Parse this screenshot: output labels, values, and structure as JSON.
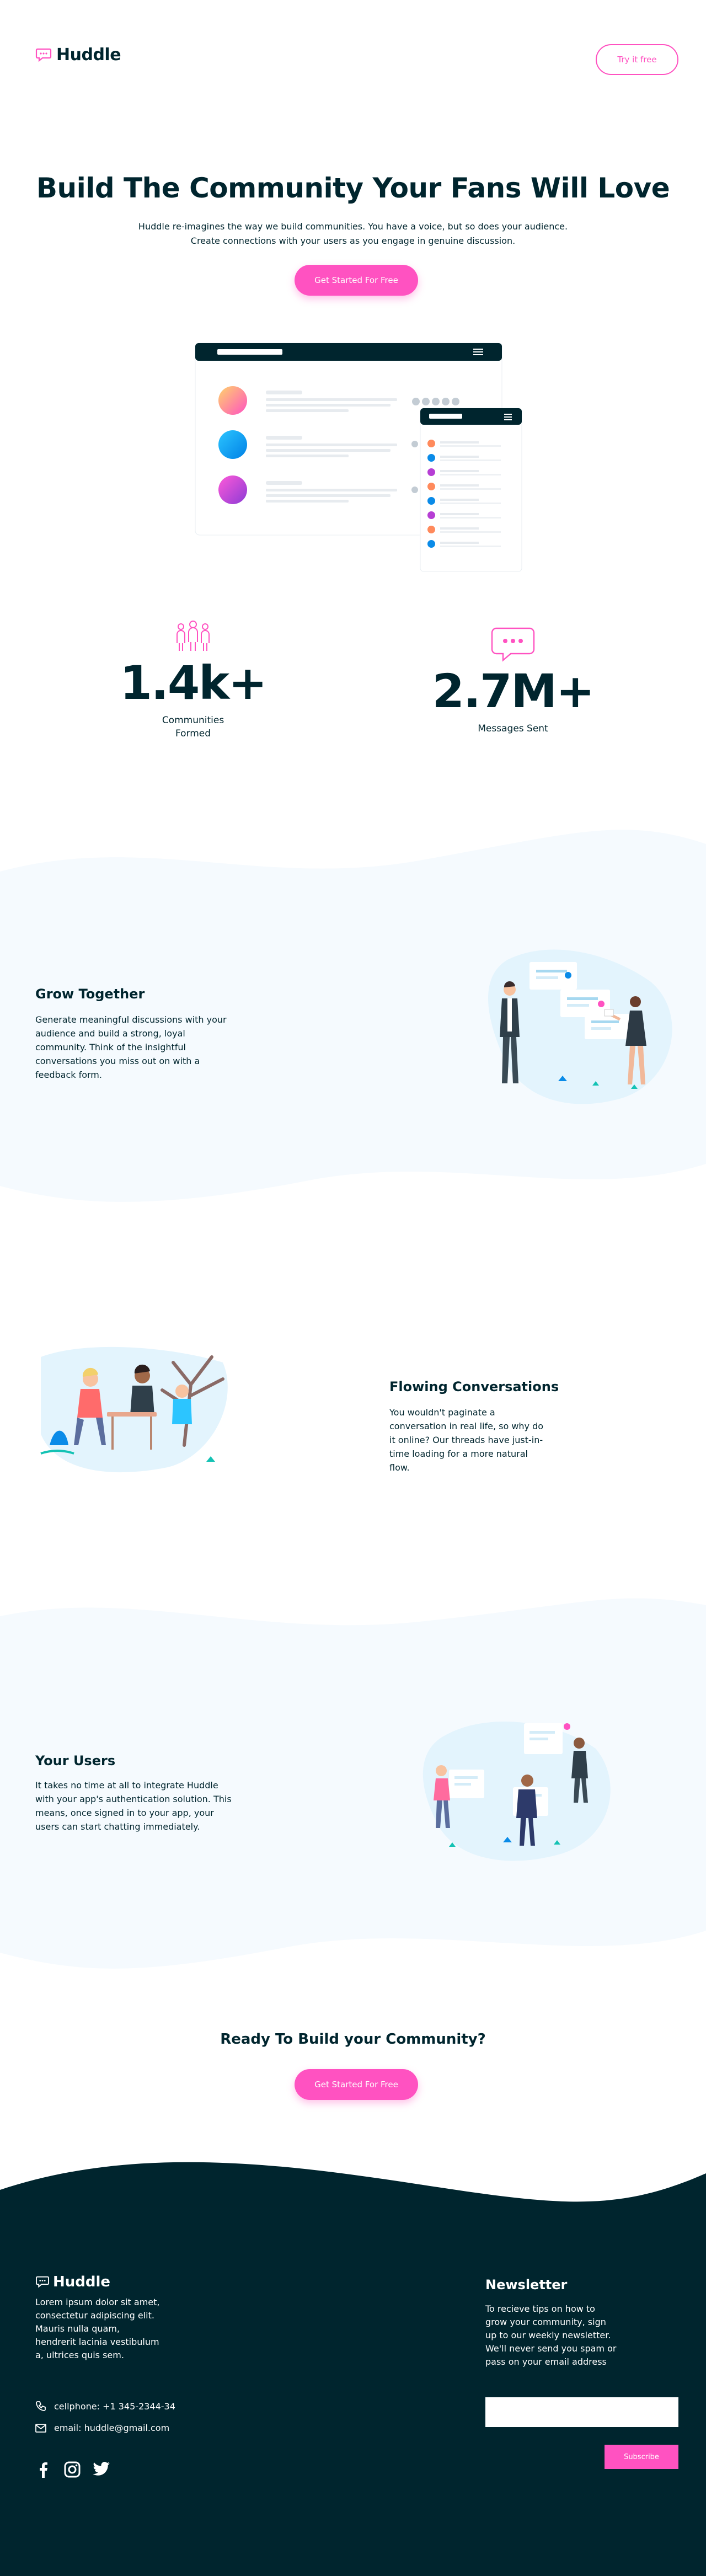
{
  "header": {
    "logo_text": "Huddle",
    "try_button": "Try it free"
  },
  "hero": {
    "title": "Build The Community Your Fans Will Love",
    "description": "Huddle re-imagines the way we build communities. You have a voice, but so does your audience. Create connections with your users as you engage in genuine discussion.",
    "cta": "Get Started For Free"
  },
  "stats": [
    {
      "value": "1.4k+",
      "label": "Communities Formed",
      "icon": "people-icon"
    },
    {
      "value": "2.7M+",
      "label": "Messages Sent",
      "icon": "chat-bubble-icon"
    }
  ],
  "features": [
    {
      "title": "Grow Together",
      "text": "Generate meaningful discussions with your audience and build a strong, loyal community. Think of the insightful conversations you miss out on with a feedback form."
    },
    {
      "title": "Flowing Conversations",
      "text": "You wouldn't paginate a conversation in real life, so why do it online? Our threads have just-in-time loading for a more natural flow."
    },
    {
      "title": "Your Users",
      "text": "It takes no time at all to integrate Huddle with your app's authentication solution. This means, once signed in to your app, your users can start chatting immediately."
    }
  ],
  "ready": {
    "title": "Ready To Build your Community?",
    "cta": "Get Started For Free"
  },
  "footer": {
    "logo_text": "Huddle",
    "description": "Lorem ipsum dolor sit amet, consectetur adipiscing elit. Mauris nulla quam, hendrerit lacinia vestibulum a, ultrices quis sem.",
    "phone": "cellphone: +1 345-2344-34",
    "email": "email: huddle@gmail.com",
    "social": [
      "facebook-icon",
      "instagram-icon",
      "twitter-icon"
    ],
    "newsletter": {
      "title": "Newsletter",
      "description": "To recieve tips on how to grow your community, sign up to our weekly newsletter. We'll never send you spam or pass on your email address",
      "input_value": "",
      "button": "Subscribe"
    }
  },
  "colors": {
    "accent": "#ff52c1",
    "dark": "#00252e",
    "light_band": "#f5fafe",
    "illustration_blue": "#e3f4fd"
  }
}
